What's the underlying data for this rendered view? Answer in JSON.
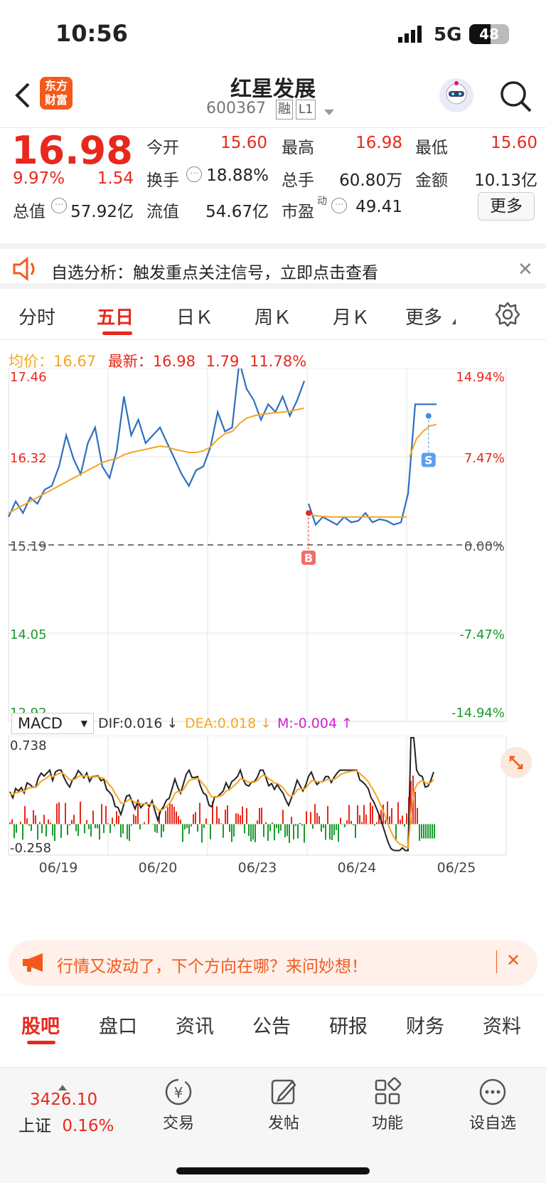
{
  "status": {
    "time": "10:56",
    "network": "5G",
    "battery": "48"
  },
  "header": {
    "title": "红星发展",
    "code": "600367",
    "tag1": "融",
    "tag2": "L1",
    "logo_line1": "东方",
    "logo_line2": "财富"
  },
  "quote": {
    "price": "16.98",
    "change_pct": "9.97%",
    "change": "1.54",
    "open_label": "今开",
    "open": "15.60",
    "high_label": "最高",
    "high": "16.98",
    "low_label": "最低",
    "low": "15.60",
    "turnover_label": "换手",
    "turnover": "18.88%",
    "volume_label": "总手",
    "volume": "60.80万",
    "amount_label": "金额",
    "amount": "10.13亿",
    "mktcap_label": "总值",
    "mktcap": "57.92亿",
    "float_label": "流值",
    "float": "54.67亿",
    "pe_label": "市盈",
    "pe_sup": "动",
    "pe": "49.41",
    "more_button": "更多"
  },
  "alert": {
    "text": "自选分析：触发重点关注信号，立即点击查看"
  },
  "tabs": {
    "fenshi": "分时",
    "wuri": "五日",
    "rik": "日Ｋ",
    "zhouk": "周Ｋ",
    "yuek": "月Ｋ",
    "more": "更多"
  },
  "chart_header": {
    "avg_label": "均价：",
    "avg": "16.67",
    "latest_label": "最新：",
    "latest": "16.98",
    "chg": "1.79",
    "chg_pct": "11.78%"
  },
  "colors": {
    "up": "#e8281c",
    "down": "#1a9a2e",
    "price_line": "#2f6fbf",
    "avg_line": "#f5a623",
    "accent": "#f25a1c"
  },
  "chart_data": {
    "type": "line",
    "price_axis": {
      "labels": [
        "17.46",
        "16.32",
        "15.19",
        "14.05",
        "12.92"
      ]
    },
    "pct_axis": {
      "labels": [
        "14.94%",
        "7.47%",
        "0.00%",
        "-7.47%",
        "-14.94%"
      ]
    },
    "dates": [
      "06/19",
      "06/20",
      "06/23",
      "06/24",
      "06/25"
    ],
    "ylim": [
      12.92,
      17.46
    ],
    "prev_close": 15.19,
    "series": [
      {
        "values": [
          15.55,
          15.75,
          15.6,
          15.8,
          15.72,
          15.9,
          15.95,
          16.2,
          16.6,
          16.3,
          16.1,
          16.5,
          16.7,
          16.2,
          16.05,
          16.4,
          17.1,
          16.6,
          16.8,
          16.5,
          16.6,
          16.7,
          16.5,
          16.3,
          16.1,
          15.95,
          16.15,
          16.2,
          16.45,
          16.9,
          16.65,
          16.7,
          17.55,
          17.2,
          17.05,
          16.8,
          17.0,
          16.9,
          17.1,
          16.85,
          17.05,
          17.3
        ]
      },
      {
        "values": [
          15.72,
          15.45,
          15.55,
          15.5,
          15.45,
          15.55,
          15.48,
          15.5,
          15.6,
          15.48,
          15.52,
          15.5,
          15.45,
          15.48,
          15.85,
          17.0,
          17.0,
          17.0,
          17.0
        ]
      },
      {
        "name": "均价",
        "values": [
          15.6,
          15.65,
          15.7,
          15.75,
          15.8,
          15.85,
          15.9,
          15.95,
          16.0,
          16.05,
          16.1,
          16.15,
          16.2,
          16.25,
          16.28,
          16.3,
          16.35,
          16.38,
          16.4,
          16.42,
          16.44,
          16.46,
          16.45,
          16.42,
          16.4,
          16.38,
          16.38,
          16.4,
          16.45,
          16.55,
          16.62,
          16.65,
          16.75,
          16.82,
          16.85,
          16.87,
          16.88,
          16.89,
          16.9,
          16.91,
          16.93,
          16.95
        ]
      }
    ]
  },
  "macd": {
    "selector": "MACD",
    "dif": "DIF:0.016 ↓",
    "dea": "DEA:0.018 ↓",
    "m": "M:-0.004 ↑",
    "top": "0.738",
    "bottom": "-0.258"
  },
  "markers": {
    "buy": "B",
    "sell": "S"
  },
  "banner": {
    "text": "行情又波动了，下个方向在哪？来问妙想！"
  },
  "bottom_tabs": [
    "股吧",
    "盘口",
    "资讯",
    "公告",
    "研报",
    "财务",
    "资料"
  ],
  "dock": {
    "index_value": "3426.10",
    "index_name": "上证",
    "index_pct": "0.16%",
    "trade": "交易",
    "post": "发帖",
    "func": "功能",
    "watch": "设自选"
  }
}
